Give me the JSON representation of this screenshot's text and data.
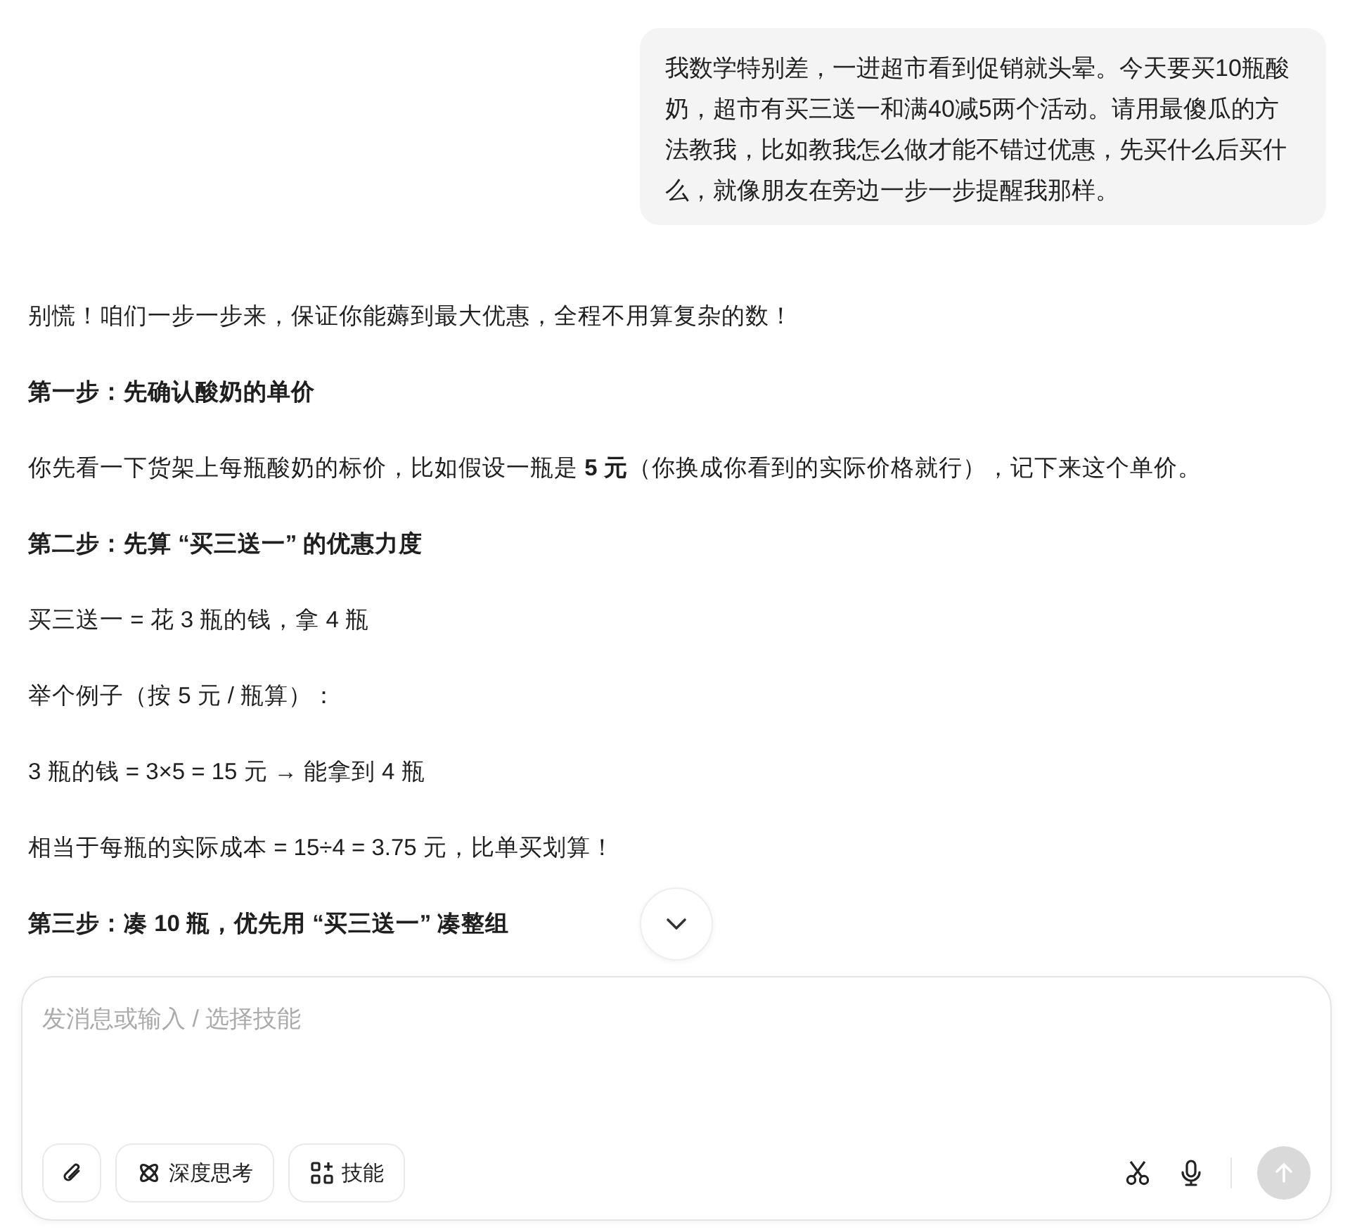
{
  "user_message": {
    "text": "我数学特别差，一进超市看到促销就头晕。今天要买10瓶酸奶，超市有买三送一和满40减5两个活动。请用最傻瓜的方法教我，比如教我怎么做才能不错过优惠，先买什么后买什么，就像朋友在旁边一步一步提醒我那样。"
  },
  "assistant_message": {
    "paragraphs": [
      {
        "kind": "text",
        "text": "别慌！咱们一步一步来，保证你能薅到最大优惠，全程不用算复杂的数！"
      },
      {
        "kind": "heading",
        "text": "第一步：先确认酸奶的单价"
      },
      {
        "kind": "text",
        "text": "你先看一下货架上每瓶酸奶的标价，比如假设一瓶是 **5 元**（你换成你看到的实际价格就行），记下来这个单价。"
      },
      {
        "kind": "heading",
        "text": "第二步：先算 “买三送一” 的优惠力度"
      },
      {
        "kind": "text",
        "text": "买三送一 = 花 3 瓶的钱，拿 4 瓶"
      },
      {
        "kind": "text",
        "text": "举个例子（按 5 元 / 瓶算）："
      },
      {
        "kind": "text",
        "text": "3 瓶的钱 = 3×5 = 15 元 → 能拿到 4 瓶"
      },
      {
        "kind": "text",
        "text": "相当于每瓶的实际成本 = 15÷4 = 3.75 元，比单买划算！"
      },
      {
        "kind": "heading",
        "text": "第三步：凑 10 瓶，优先用 “买三送一” 凑整组"
      }
    ]
  },
  "composer": {
    "placeholder": "发消息或输入 / 选择技能",
    "buttons": [
      {
        "kind": "attach"
      },
      {
        "kind": "deep-think",
        "label": "深度思考"
      },
      {
        "kind": "skills",
        "label": "技能"
      }
    ],
    "send": {
      "disabled": true
    }
  }
}
